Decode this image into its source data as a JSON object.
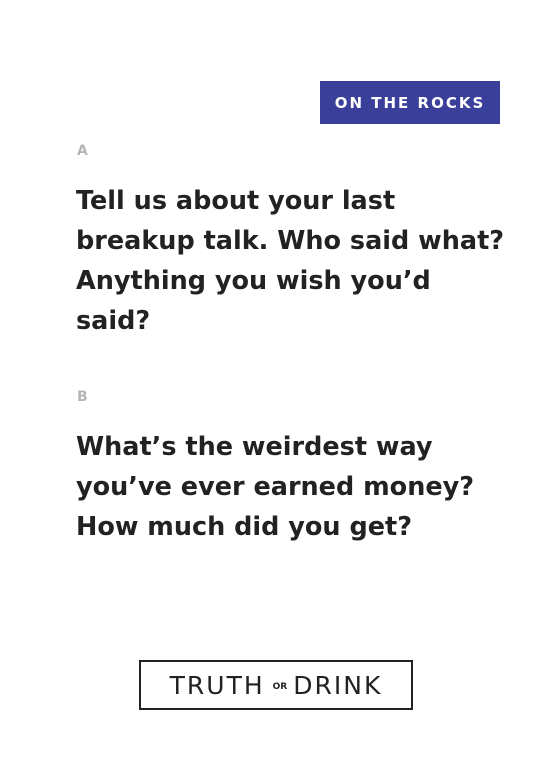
{
  "badge": {
    "label": "ON THE ROCKS"
  },
  "questions": [
    {
      "letter": "A",
      "text": "Tell us about your last breakup talk. Who said what? Anything you wish you’d said?"
    },
    {
      "letter": "B",
      "text": "What’s the weirdest way you’ve ever earned money? How much did you get?"
    }
  ],
  "logo": {
    "left_word": "TRUTH",
    "connector": "OR",
    "right_word": "DRINK"
  },
  "colors": {
    "badge_background": "#3a3f9a",
    "text": "#222222",
    "letter_label": "#b6b6b6"
  }
}
